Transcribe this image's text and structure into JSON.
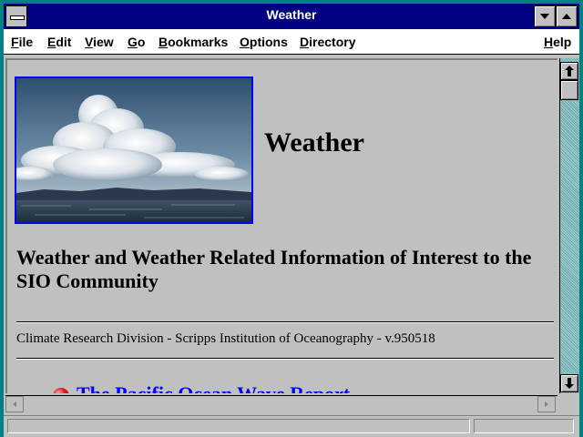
{
  "window": {
    "title": "Weather"
  },
  "menu": {
    "items": [
      {
        "label": "File",
        "access": "F",
        "rest": "ile"
      },
      {
        "label": "Edit",
        "access": "E",
        "rest": "dit"
      },
      {
        "label": "View",
        "access": "V",
        "rest": "iew"
      },
      {
        "label": "Go",
        "access": "G",
        "rest": "o"
      },
      {
        "label": "Bookmarks",
        "access": "B",
        "rest": "ookmarks"
      },
      {
        "label": "Options",
        "access": "O",
        "rest": "ptions"
      },
      {
        "label": "Directory",
        "access": "D",
        "rest": "irectory"
      },
      {
        "label": "Help",
        "access": "H",
        "rest": "elp"
      }
    ]
  },
  "page": {
    "heading": "Weather",
    "subheading": "Weather and Weather Related Information of Interest to the SIO Community",
    "footer": "Climate Research Division - Scripps Institution of Oceanography - v.950518",
    "link_text": "The Pacific Ocean Wave Report",
    "image_icon": "clouds-over-ocean-photo"
  },
  "status": {
    "text": ""
  },
  "colors": {
    "titlebar": "#000080",
    "window_frame": "#008080",
    "link": "#0000ff",
    "content_bg": "#c0c0c0"
  }
}
